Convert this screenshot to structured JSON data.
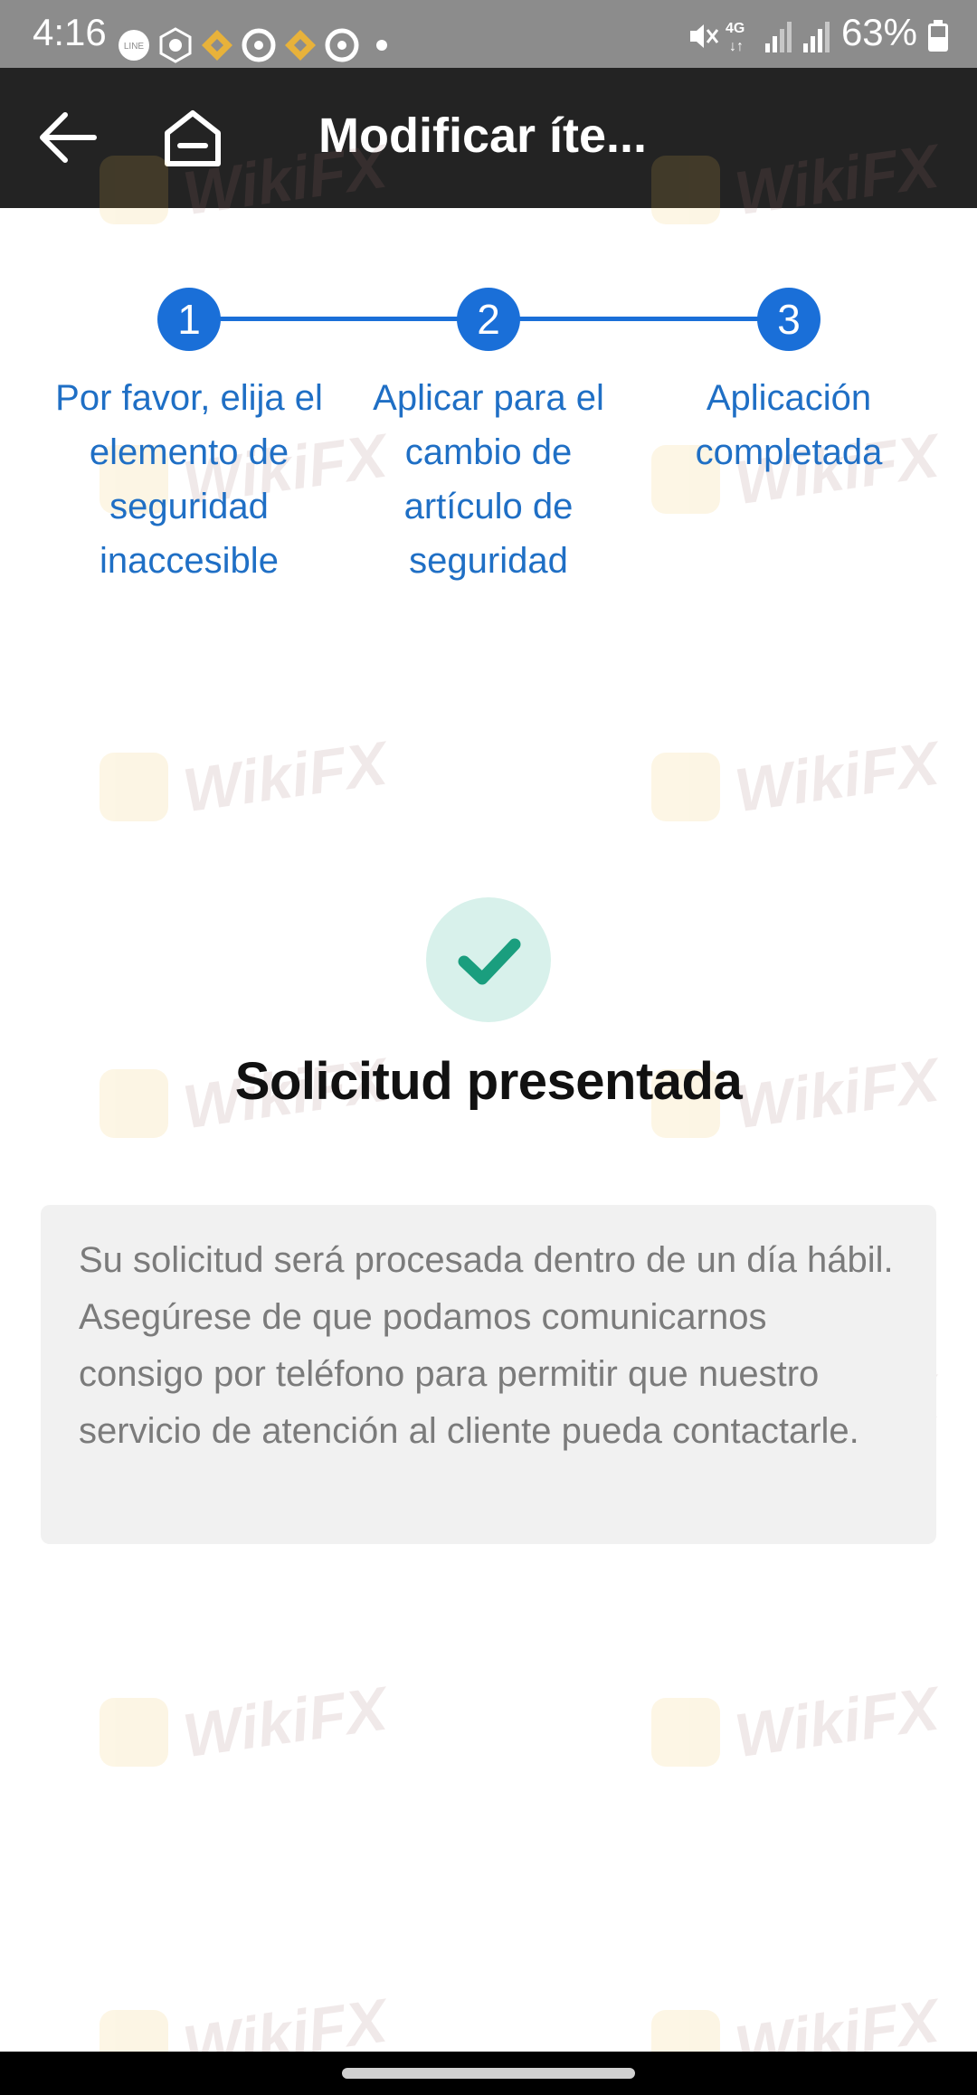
{
  "status_bar": {
    "time": "4:16",
    "battery": "63%",
    "left_icons": [
      "line-icon",
      "crypto-icon",
      "binance-icon",
      "circle-icon",
      "binance-icon",
      "circle-icon",
      "dot-icon"
    ],
    "right_icons": [
      "mute-icon",
      "4g-icon",
      "signal-icon",
      "signal-icon",
      "battery-icon"
    ]
  },
  "app_bar": {
    "title": "Modificar íte..."
  },
  "stepper": {
    "color": "#1a6fd8",
    "steps": [
      {
        "number": "1",
        "label": "Por favor, elija el elemento de seguridad inaccesible"
      },
      {
        "number": "2",
        "label": "Aplicar para el cambio de artículo de seguridad"
      },
      {
        "number": "3",
        "label": "Aplicación completada"
      }
    ]
  },
  "result": {
    "title": "Solicitud presentada",
    "message": "Su solicitud será procesada dentro de un día hábil. Asegúrese de que podamos comunicarnos consigo por teléfono para permitir que nuestro servicio de atención al cliente pueda contactarle.",
    "accent": "#1a9e7e"
  },
  "watermark": "WikiFX"
}
